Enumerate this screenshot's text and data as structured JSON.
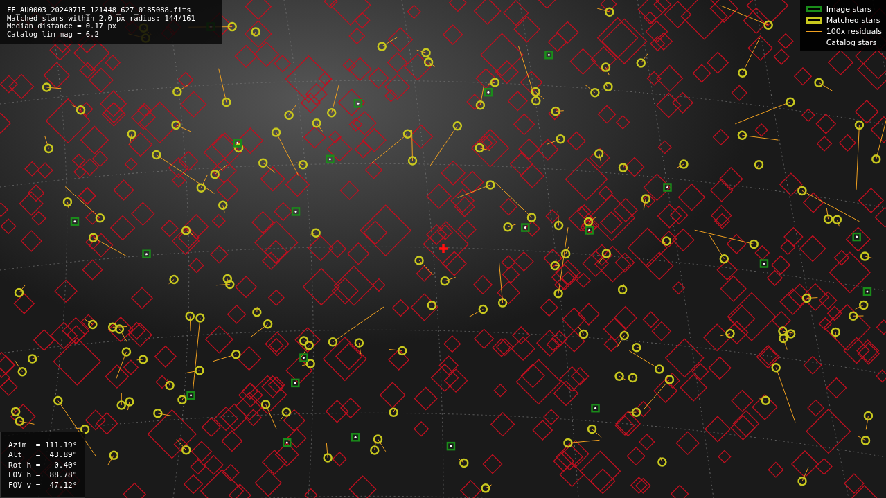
{
  "info_panel": {
    "lines": [
      "FF_AU0003_20240715_121448_627_0185088.fits",
      "Matched stars within 2.0 px radius: 144/161",
      "Median distance = 0.17 px",
      "Catalog lim mag = 6.2"
    ]
  },
  "legend": [
    {
      "kind": "box",
      "label": "Image stars",
      "color": "#1a8c1a"
    },
    {
      "kind": "box",
      "label": "Matched stars",
      "color": "#c8c81e"
    },
    {
      "kind": "line",
      "label": "100x residuals",
      "color": "#f0a020"
    },
    {
      "kind": "none",
      "label": "Catalog stars"
    }
  ],
  "pointing_panel": {
    "lines": [
      "Azim  = 111.19°",
      "Alt   =  43.89°",
      "Rot h =   0.40°",
      "FOV h =  88.78°",
      "FOV v =  47.12°"
    ]
  }
}
